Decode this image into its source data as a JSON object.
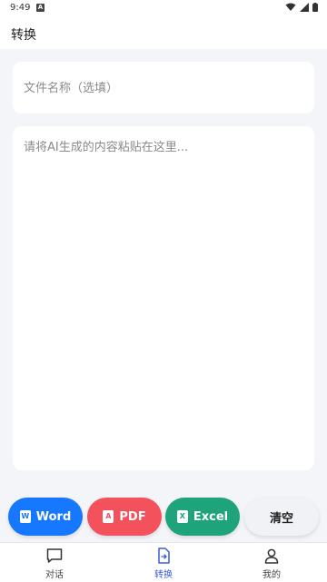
{
  "status_bar": {
    "time": "9:49",
    "notification_letter": "A"
  },
  "header": {
    "title": "转换"
  },
  "form": {
    "filename_placeholder": "文件名称（选填）",
    "content_placeholder": "请将AI生成的内容粘贴在这里..."
  },
  "actions": {
    "word_label": "Word",
    "pdf_label": "PDF",
    "excel_label": "Excel",
    "clear_label": "清空",
    "word_icon_letter": "W",
    "pdf_icon_letter": "A",
    "excel_icon_letter": "X"
  },
  "colors": {
    "word": "#1677ff",
    "pdf": "#f3515c",
    "excel": "#1fa37a",
    "active_nav": "#3b5bdb"
  },
  "bottom_nav": {
    "items": [
      {
        "label": "对话",
        "icon": "chat-icon"
      },
      {
        "label": "转换",
        "icon": "document-convert-icon",
        "active": true
      },
      {
        "label": "我的",
        "icon": "user-icon"
      }
    ]
  }
}
